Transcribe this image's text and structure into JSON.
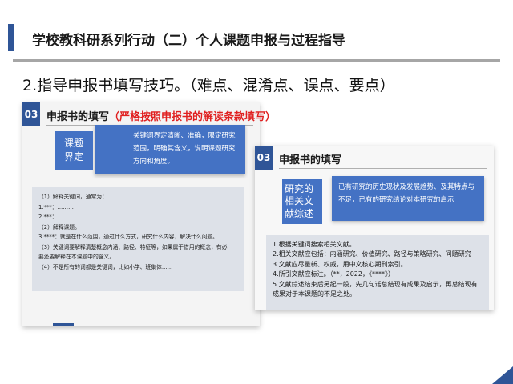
{
  "header": {
    "title": "学校教科研系列行动（二）个人课题申报与过程指导"
  },
  "subtitle": "2.指导申报书填写技巧。（难点、混淆点、误点、要点）",
  "left_card": {
    "number": "03",
    "heading": "申报书的填写",
    "heading_red": "（严格按照申报书的解读条款填写）",
    "tag": "课题\n界定",
    "description": "关键词界定清晰、准确，限定研究范围，明确其含义，说明课题研究方向和角度。",
    "list": [
      "（1）解释关键词，通常为：",
      "1.***：………",
      "2.***：………",
      "（2）解释课题。",
      "3.****：就是在什么范围，通过什么方式，研究什么内容，解决什么问题。",
      "（3）关键词要解释清楚概念内涵、路径、特征等，如果属于借用的概念，有必",
      "要还要解释在本课题中的含义。",
      "（4）不是所有的词都是关键词，比如小学、班集体……"
    ]
  },
  "right_card": {
    "number": "03",
    "heading": "申报书的填写",
    "tag": "研究的相关文献综述",
    "description": "已有研究的历史现状及发展趋势、及其特点与不足，已有的研究结论对本研究的启示",
    "list": [
      "1.根据关键词搜索相关文献。",
      "2.相关文献应包括：内涵研究、价值研究、路径与策略研究、问题研究",
      "3.文献应尽量新、权威，用中文核心期刊索引。",
      "4.所引文献应标注。（**，2022，《****》）",
      "5.文献综述结束后另起一段，先几句话总结现有成果及启示，再总结现有成果对于本课题的不足之处。"
    ]
  },
  "colors": {
    "accent": "#2f5597",
    "tag_blue": "#4472c4",
    "highlight_red": "#e02020"
  }
}
